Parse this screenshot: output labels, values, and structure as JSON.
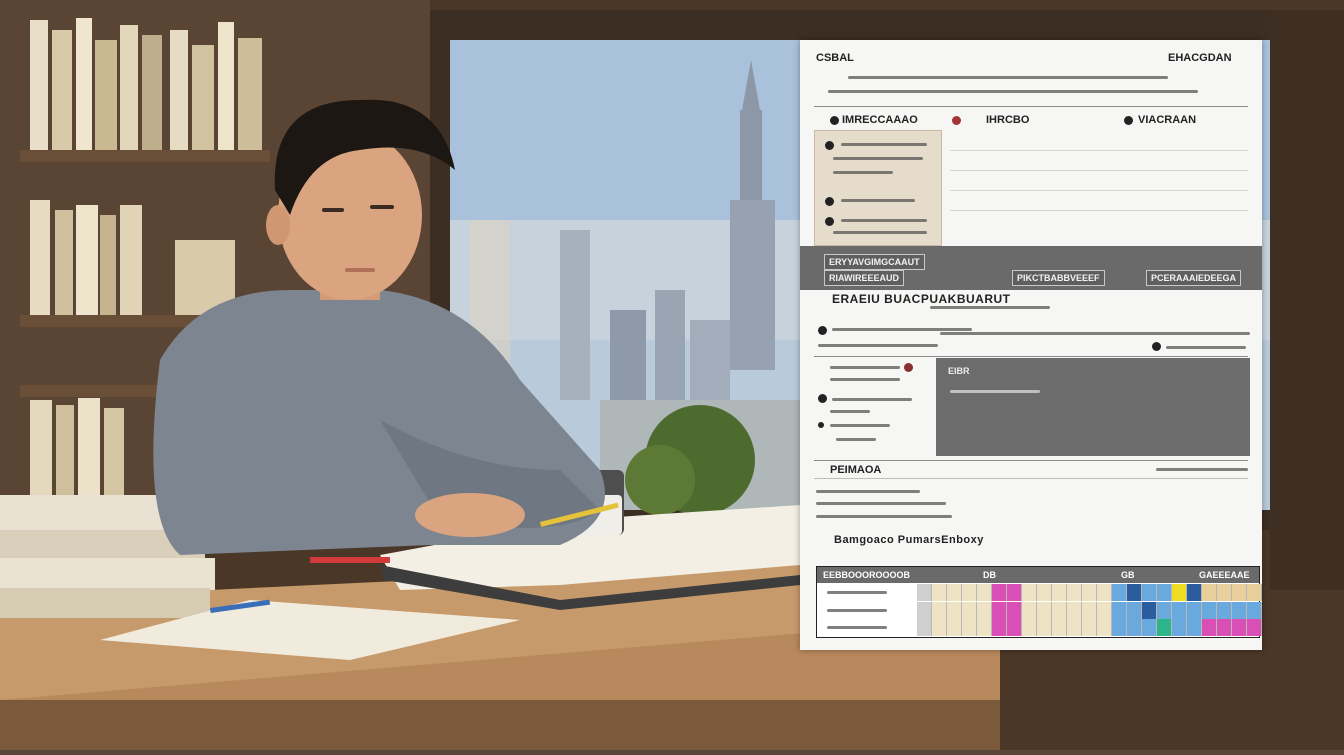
{
  "scene": {
    "description_tags": [
      "student",
      "desk",
      "books",
      "window",
      "city-skyline"
    ],
    "colors": {
      "wall": "#4a3728",
      "window_sky": "#b9cadb",
      "desk": "#b8895c",
      "shirt": "#7d8690",
      "skin": "#d9a47f",
      "hair": "#1d1714"
    }
  },
  "sheet": {
    "logo": "CSBAL",
    "top_right": "EHACGDAN",
    "col_headers": [
      "IMRECCAAAO",
      "IHRCBO",
      "VIACRAAN"
    ],
    "bar_labels": [
      "ERYYAVGIMGCAAUT",
      "RIAWIREEEAUD",
      "PIKCTBABBVEEEF",
      "PCERAAAIEDEEGA"
    ],
    "section_title": "ERAEIU BUACPUAKBUARUT",
    "panel_line": "EIBR",
    "footer_left": "PEIMAOA",
    "chart_title": "Bamgoaco PumarsEnboxy",
    "grid_headers": [
      "EEBBOOOROOOOB",
      "DB",
      "GB",
      "GAEEEAAE"
    ],
    "grid_colors": {
      "pink": "#d94fb6",
      "gray": "#cfcfcf",
      "cream": "#efe3c6",
      "blue": "#6aa9dd",
      "navy": "#2b5d9e",
      "yellow": "#f0dc22",
      "green": "#2db48a",
      "sand": "#e8cf9b"
    }
  }
}
